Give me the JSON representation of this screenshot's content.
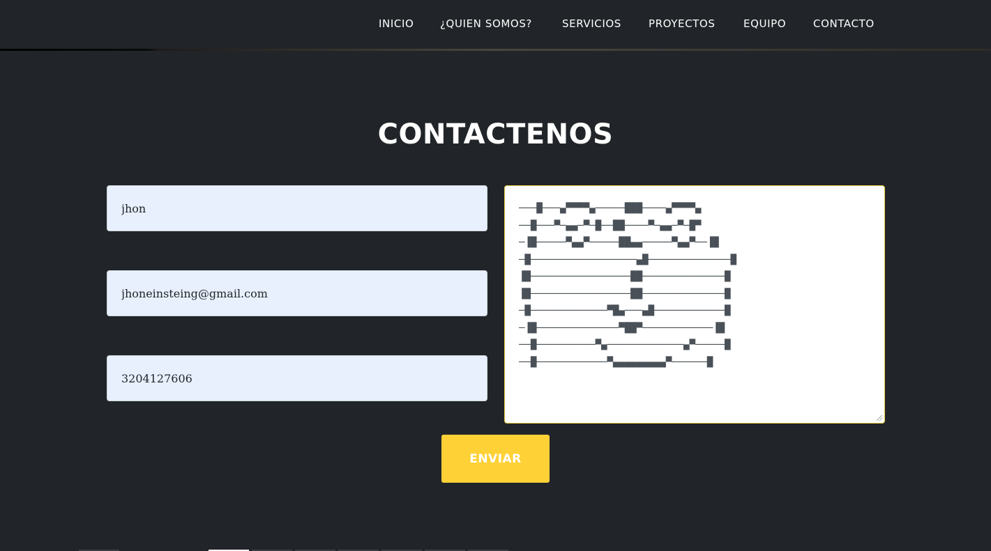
{
  "nav": {
    "items": [
      {
        "label": "INICIO"
      },
      {
        "label": "¿QUIEN SOMOS?"
      },
      {
        "label": "SERVICIOS"
      },
      {
        "label": "PROYECTOS"
      },
      {
        "label": "EQUIPO"
      },
      {
        "label": "CONTACTO"
      }
    ]
  },
  "contact": {
    "title": "CONTACTENOS",
    "name_value": "jhon",
    "email_value": "jhoneinsteing@gmail.com",
    "phone_value": "3204127606",
    "message_value": "───█───▄▀▀▀▀▄─────███────▄▀▀▀▀▄\n──█───▀─▄▄─▀─█──██────▀─▄▄─▀─█▀\n─▐█─────▀▄▄▀─────██▄▄─────▀▄▄▀──▐█\n─█──────────────────▄█──────────────█\n▐█─────────────────██──────────────█\n▐█─────────────────██──────────────█\n─█─────────────▀█▄───▄█────────────█\n─▐█──────────────▀██▀────────────▐█\n──█──────────▀▄─────────────▄▀─────█\n──█────────────▀▄▄▄▄▄▄▄▄▄▀──────█",
    "submit_label": "ENVIAR"
  },
  "colors": {
    "background": "#212529",
    "accent": "#fed136",
    "field_bg": "#e8f0fe"
  }
}
